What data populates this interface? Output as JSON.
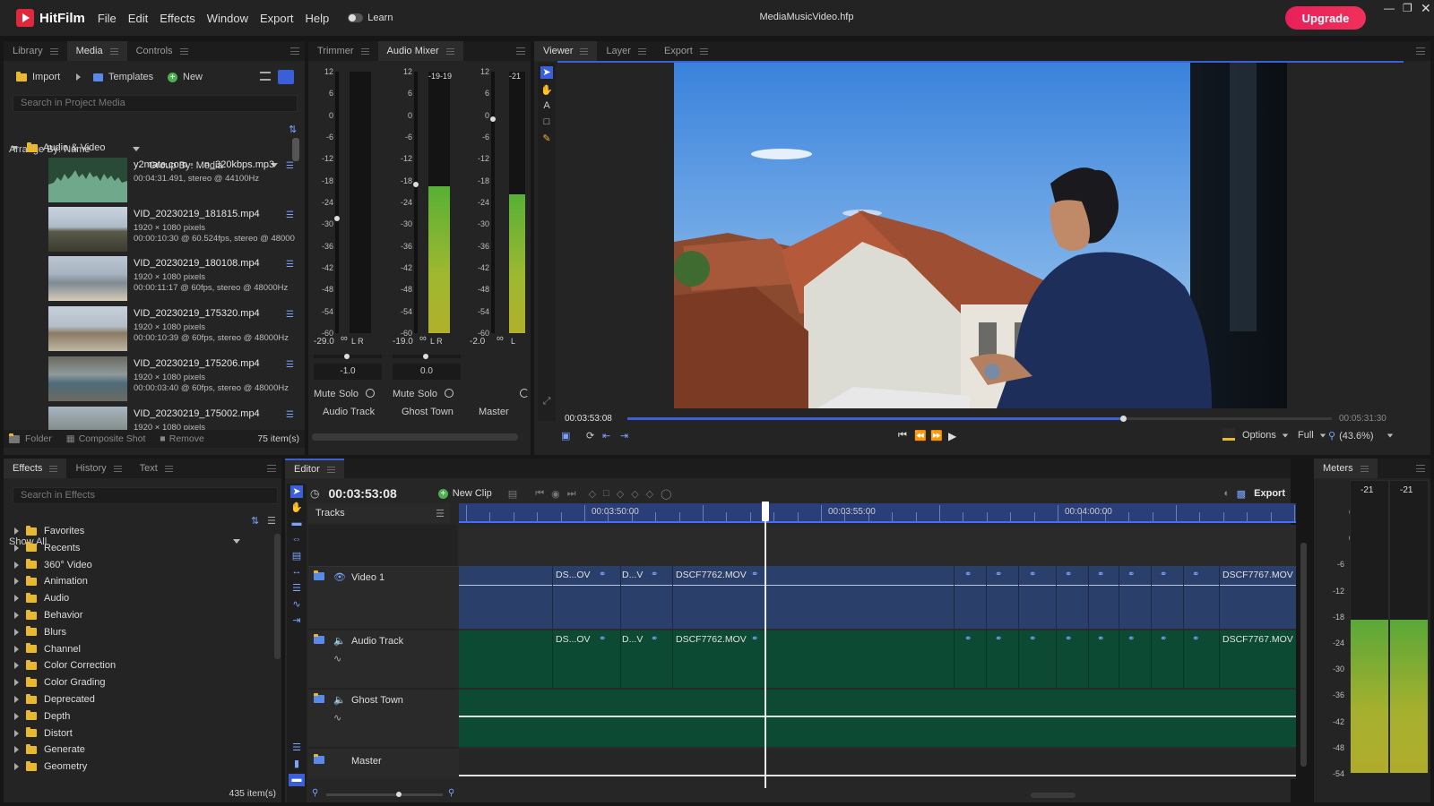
{
  "app": {
    "name": "HitFilm",
    "document_title": "MediaMusicVideo.hfp",
    "upgrade_label": "Upgrade",
    "learn_label": "Learn"
  },
  "menu": [
    "File",
    "Edit",
    "Effects",
    "Window",
    "Export",
    "Help"
  ],
  "library": {
    "tabs": [
      "Library",
      "Media",
      "Controls"
    ],
    "active_tab": "Media",
    "import_label": "Import",
    "templates_label": "Templates",
    "new_label": "New",
    "search_placeholder": "Search in Project Media",
    "arrange_by": "Arrange By: Name",
    "group_by": "Group By: Media",
    "folder_name": "Audio & Video",
    "items": [
      {
        "name": "y2mate.com - ...n_320kbps.mp3",
        "details": [
          "00:04:31.491, stereo @ 44100Hz"
        ]
      },
      {
        "name": "VID_20230219_181815.mp4",
        "details": [
          "1920 × 1080 pixels",
          "00:00:10:30 @ 60.524fps, stereo @ 48000"
        ]
      },
      {
        "name": "VID_20230219_180108.mp4",
        "details": [
          "1920 × 1080 pixels",
          "00:00:11:17 @ 60fps, stereo @ 48000Hz"
        ]
      },
      {
        "name": "VID_20230219_175320.mp4",
        "details": [
          "1920 × 1080 pixels",
          "00:00:10:39 @ 60fps, stereo @ 48000Hz"
        ]
      },
      {
        "name": "VID_20230219_175206.mp4",
        "details": [
          "1920 × 1080 pixels",
          "00:00:03:40 @ 60fps, stereo @ 48000Hz"
        ]
      },
      {
        "name": "VID_20230219_175002.mp4",
        "details": [
          "1920 × 1080 pixels"
        ]
      }
    ],
    "footer": {
      "folder": "Folder",
      "composite": "Composite Shot",
      "remove": "Remove",
      "count": "75 item(s)"
    }
  },
  "mixer": {
    "tabs": [
      "Trimmer",
      "Audio Mixer"
    ],
    "active_tab": "Audio Mixer",
    "scale": [
      "12",
      "6",
      "0",
      "-6",
      "-12",
      "-18",
      "-24",
      "-30",
      "-36",
      "-42",
      "-48",
      "-54",
      "-60"
    ],
    "channels": [
      {
        "name": "Audio Track",
        "fader_value": "-29.0",
        "peak": "",
        "pan_value": "-1.0",
        "fader_level": 0.44,
        "meter_level": 0,
        "lr": "L R"
      },
      {
        "name": "Ghost Town",
        "fader_value": "-19.0",
        "peak": "-19-19",
        "pan_value": "0.0",
        "fader_level": 0.57,
        "meter_level": 0.56,
        "lr": "L R"
      },
      {
        "name": "Master",
        "fader_value": "-2.0",
        "peak": "-21",
        "pan_value": "",
        "fader_level": 0.82,
        "meter_level": 0.53,
        "lr": "L"
      }
    ],
    "mute_label": "Mute",
    "solo_label": "Solo",
    "infinity": "∞"
  },
  "viewer": {
    "tabs": [
      "Viewer",
      "Layer",
      "Export"
    ],
    "active_tab": "Viewer",
    "current_time": "00:03:53:08",
    "end_time": "00:05:31:30",
    "playhead_fraction": 0.703,
    "options_label": "Options",
    "quality_label": "Full",
    "zoom_label": "(43.6%)"
  },
  "effects": {
    "tabs": [
      "Effects",
      "History",
      "Text"
    ],
    "active_tab": "Effects",
    "search_placeholder": "Search in Effects",
    "show_all": "Show All",
    "categories": [
      "Favorites",
      "Recents",
      "360° Video",
      "Animation",
      "Audio",
      "Behavior",
      "Blurs",
      "Channel",
      "Color Correction",
      "Color Grading",
      "Deprecated",
      "Depth",
      "Distort",
      "Generate",
      "Geometry"
    ],
    "count": "435 item(s)"
  },
  "editor": {
    "tab": "Editor",
    "timecode": "00:03:53:08",
    "new_clip_label": "New Clip",
    "export_label": "Export",
    "tracks_label": "Tracks",
    "ruler": [
      "00:03:50:00",
      "00:03:55:00",
      "00:04:00:00"
    ],
    "tracks": [
      {
        "name": "Video 1",
        "type": "video"
      },
      {
        "name": "Audio Track",
        "type": "audio"
      },
      {
        "name": "Ghost Town",
        "type": "audio"
      },
      {
        "name": "Master",
        "type": "master"
      }
    ],
    "clip_labels": [
      "DS...OV",
      "D...V",
      "DSCF7762.MOV",
      "DSCF7767.MOV"
    ]
  },
  "meters": {
    "tab": "Meters",
    "peaks": [
      "-21",
      "-21"
    ],
    "scale": [
      "6",
      "0",
      "-6",
      "-12",
      "-18",
      "-24",
      "-30",
      "-36",
      "-42",
      "-48",
      "-54"
    ],
    "levels": [
      0.52,
      0.52
    ]
  },
  "colors": {
    "accent": "#4a6cf7",
    "video_track": "#2a3f6a",
    "audio_track": "#0c4a34",
    "meter_green": "#8fb832",
    "upgrade": "#e8205a"
  }
}
